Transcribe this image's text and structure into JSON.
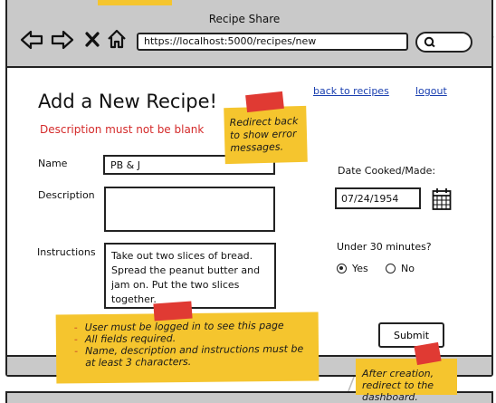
{
  "browser": {
    "window_title": "Recipe Share",
    "url": "https://localhost:5000/recipes/new",
    "nav_icons": [
      "back-arrow-icon",
      "forward-arrow-icon",
      "close-icon",
      "home-icon"
    ],
    "search_icon": "search-icon"
  },
  "header": {
    "title": "Add a New Recipe!",
    "back_link": "back to recipes",
    "logout_link": "logout",
    "error_message": "Description must not be blank"
  },
  "form": {
    "name_label": "Name",
    "name_value": "PB & J",
    "description_label": "Description",
    "description_value": "",
    "instructions_label": "Instructions",
    "instructions_value": "Take out two slices of bread. Spread the peanut butter and jam on. Put the two slices together.",
    "date_label": "Date Cooked/Made:",
    "date_value": "07/24/1954",
    "under30_label": "Under 30 minutes?",
    "yes_label": "Yes",
    "no_label": "No",
    "under30_selected": "Yes",
    "submit_label": "Submit"
  },
  "notes": {
    "redirect_note": "Redirect back to show error messages.",
    "rules": [
      "User must be logged in to see this page",
      "All fields required.",
      "Name, description and instructions must be at least 3 characters."
    ],
    "after_creation": "After creation, redirect to the dashboard."
  },
  "colors": {
    "chrome_gray": "#c9c9c9",
    "error_red": "#d42a2a",
    "link_blue": "#1a3fb0",
    "sticky_yellow": "#f5c52e",
    "tape_red": "#e03a33"
  }
}
